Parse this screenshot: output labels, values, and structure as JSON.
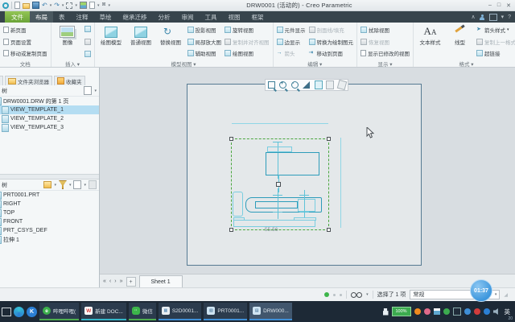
{
  "window": {
    "title": "DRW0001 (活动的)  -  Creo Parametric",
    "minimize": "–",
    "restore": "□",
    "close": "✕",
    "help": "?"
  },
  "menu": {
    "file": "文件"
  },
  "tabs": {
    "items": [
      "布局",
      "表",
      "注释",
      "草绘",
      "继承迁移",
      "分析",
      "审阅",
      "工具",
      "视图",
      "框架"
    ]
  },
  "ribbon": {
    "doc": {
      "label": "文档",
      "items": [
        "新页面",
        "页面设置",
        "移动或复制页面"
      ]
    },
    "insert": {
      "label": "插入",
      "big": "图像"
    },
    "model_views": {
      "label": "模型视图",
      "big": [
        "绘图模型",
        "普通视图",
        "替换视图"
      ],
      "col1": [
        "投影视图",
        "局部放大图",
        "辅助视图"
      ],
      "col2": [
        "旋转视图",
        "复制并对齐视图",
        "绘图视图"
      ]
    },
    "edit": {
      "label": "编辑",
      "col1": [
        "元件显示",
        "边显示",
        "箭头"
      ],
      "col2": [
        "剖面线/填充",
        "转换为绘制图元",
        "移动到页面"
      ]
    },
    "display": {
      "label": "显示",
      "items": [
        "拭除视图",
        "恢复视图",
        "显示已修改的视图"
      ]
    },
    "format": {
      "label": "格式",
      "big": [
        "文本样式",
        "线型"
      ],
      "col": [
        "箭头样式",
        "复制上一格式",
        "超链接"
      ]
    }
  },
  "navigator": {
    "tabs": [
      "文件夹浏览器",
      "收藏夹"
    ],
    "drawing_tree": {
      "header": "树",
      "items": [
        "DRW0001.DRW 的第 1 页",
        "VIEW_TEMPLATE_1",
        "VIEW_TEMPLATE_2",
        "VIEW_TEMPLATE_3"
      ]
    },
    "model_tree": {
      "header": "树",
      "items": [
        "PRT0001.PRT",
        "RIGHT",
        "TOP",
        "FRONT",
        "PRT_CSYS_DEF",
        "拉伸 1"
      ]
    }
  },
  "canvas": {
    "dimension": "55.56"
  },
  "sheet_bar": {
    "active_sheet": "Sheet 1",
    "add": "+"
  },
  "status_bar": {
    "selection_count": "选择了 1 项",
    "filter": "常规"
  },
  "overlay": {
    "timer": "01:37"
  },
  "taskbar": {
    "apps": [
      "哔哩哔哩(",
      "新建 DOC...",
      "微信",
      "S2D0001...",
      "PRT0001...",
      "DRW000..."
    ],
    "tray": {
      "battery": "100%",
      "ime": "英",
      "clock": "20"
    }
  }
}
